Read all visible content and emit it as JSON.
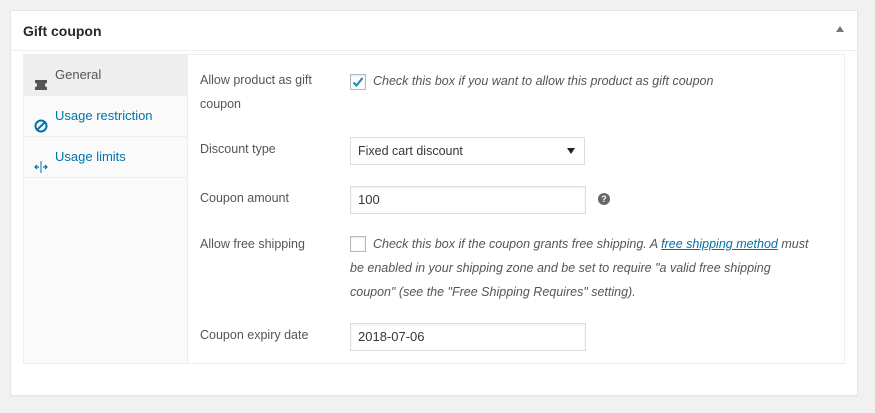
{
  "metabox": {
    "title": "Gift coupon"
  },
  "tabs": [
    {
      "label": "General",
      "icon": "ticket-icon",
      "active": true
    },
    {
      "label": "Usage restriction",
      "icon": "no-entry-icon",
      "active": false
    },
    {
      "label": "Usage limits",
      "icon": "arrows-expand-icon",
      "active": false
    }
  ],
  "fields": {
    "gift": {
      "label_line1": "Allow product as gift",
      "label_line2": "coupon",
      "checked": true,
      "description": "Check this box if you want to allow this product as gift coupon"
    },
    "discount_type": {
      "label": "Discount type",
      "value": "Fixed cart discount"
    },
    "amount": {
      "label": "Coupon amount",
      "value": "100",
      "help": "?"
    },
    "free_shipping": {
      "label": "Allow free shipping",
      "checked": false,
      "desc_part1": "Check this box if the coupon grants free shipping. A",
      "link_text": "free shipping method",
      "desc_part2": "must",
      "desc_line2": "be enabled in your shipping zone and be set to require \"a valid free shipping",
      "desc_line3": "coupon\" (see the \"Free Shipping Requires\" setting)."
    },
    "expiry": {
      "label": "Coupon expiry date",
      "value": "2018-07-06"
    }
  },
  "colors": {
    "link": "#0073aa",
    "active_tab_bg": "#eeeeee",
    "checkmark": "#1e8cbe"
  }
}
